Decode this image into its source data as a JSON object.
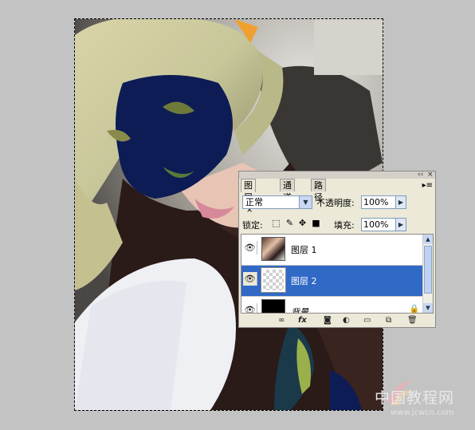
{
  "layers_panel": {
    "tabs": [
      {
        "label": "图层",
        "close": "×"
      },
      {
        "label": "通道"
      },
      {
        "label": "路径"
      }
    ],
    "blend_mode": "正常",
    "opacity_label": "不透明度:",
    "opacity_value": "100%",
    "lock_label": "锁定:",
    "fill_label": "填充:",
    "fill_value": "100%",
    "layers": [
      {
        "name": "图层 1",
        "visible": true,
        "selected": false
      },
      {
        "name": "图层 2",
        "visible": true,
        "selected": true
      },
      {
        "name": "背景",
        "visible": true,
        "selected": false,
        "locked": true
      }
    ],
    "footer_icons": [
      "link-icon",
      "fx-icon",
      "mask-icon",
      "adjustment-icon",
      "group-icon",
      "new-layer-icon",
      "trash-icon"
    ],
    "fx_label": "fx"
  },
  "watermark": {
    "title": "中国教程网",
    "url": "www.jcwcn.com"
  }
}
